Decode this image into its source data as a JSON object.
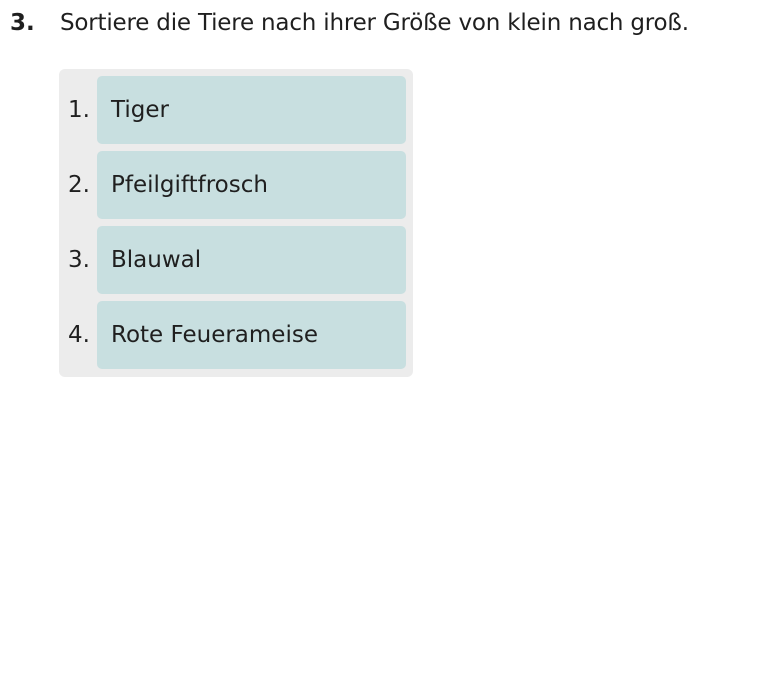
{
  "question": {
    "number": "3.",
    "text": "Sortiere die Tiere nach ihrer Größe von klein nach groß."
  },
  "sort_list": {
    "items": [
      {
        "index": "1.",
        "label": "Tiger"
      },
      {
        "index": "2.",
        "label": "Pfeilgiftfrosch"
      },
      {
        "index": "3.",
        "label": "Blauwal"
      },
      {
        "index": "4.",
        "label": "Rote Feuerameise"
      }
    ]
  },
  "colors": {
    "item_background": "#c8dfe0",
    "container_background": "#ececec",
    "text": "#1f1f1f"
  }
}
